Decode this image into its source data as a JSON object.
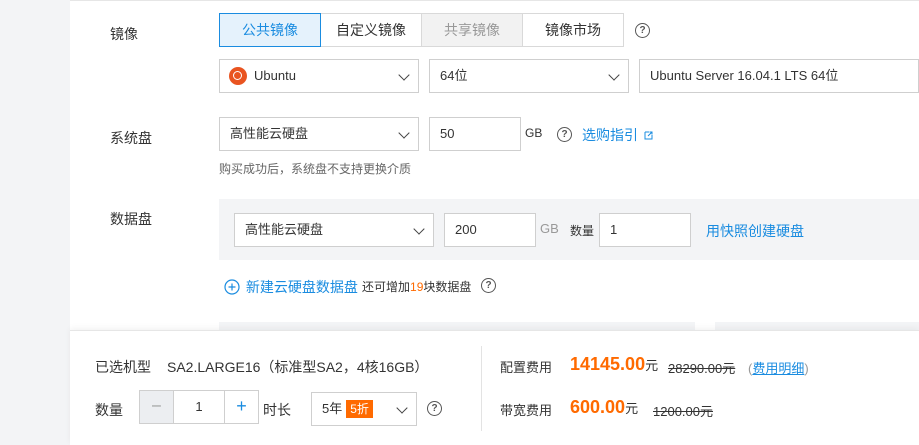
{
  "image": {
    "label": "镜像",
    "tabs": [
      {
        "label": "公共镜像",
        "state": "active"
      },
      {
        "label": "自定义镜像",
        "state": "normal"
      },
      {
        "label": "共享镜像",
        "state": "disabled"
      },
      {
        "label": "镜像市场",
        "state": "normal"
      }
    ],
    "os": "Ubuntu",
    "bits": "64位",
    "version": "Ubuntu Server 16.04.1 LTS 64位"
  },
  "system_disk": {
    "label": "系统盘",
    "type": "高性能云硬盘",
    "size": "50",
    "unit": "GB",
    "guide_link": "选购指引",
    "note": "购买成功后，系统盘不支持更换介质"
  },
  "data_disk": {
    "label": "数据盘",
    "type": "高性能云硬盘",
    "size": "200",
    "unit": "GB",
    "count_label": "数量",
    "count": "1",
    "snapshot_link": "用快照创建硬盘",
    "add_link": "新建云硬盘数据盘",
    "add_hint_prefix": "还可增加",
    "add_hint_num": "19",
    "add_hint_suffix": "块数据盘"
  },
  "footer": {
    "model_label": "已选机型",
    "model_value": "SA2.LARGE16（标准型SA2，4核16GB）",
    "qty_label": "数量",
    "qty_value": "1",
    "minus": "–",
    "plus": "+",
    "duration_label": "时长",
    "duration_value": "5年",
    "discount": "5折",
    "config_fee_label": "配置费用",
    "config_fee": "14145.00",
    "config_unit": "元",
    "config_original": "28290.00元",
    "fee_detail": "费用明细",
    "bandwidth_fee_label": "带宽费用",
    "bandwidth_fee": "600.00",
    "bandwidth_unit": "元",
    "bandwidth_original": "1200.00元"
  },
  "colors": {
    "accent": "#1a8ce0",
    "price": "#ff6a00",
    "ubuntu": "#e95420"
  }
}
